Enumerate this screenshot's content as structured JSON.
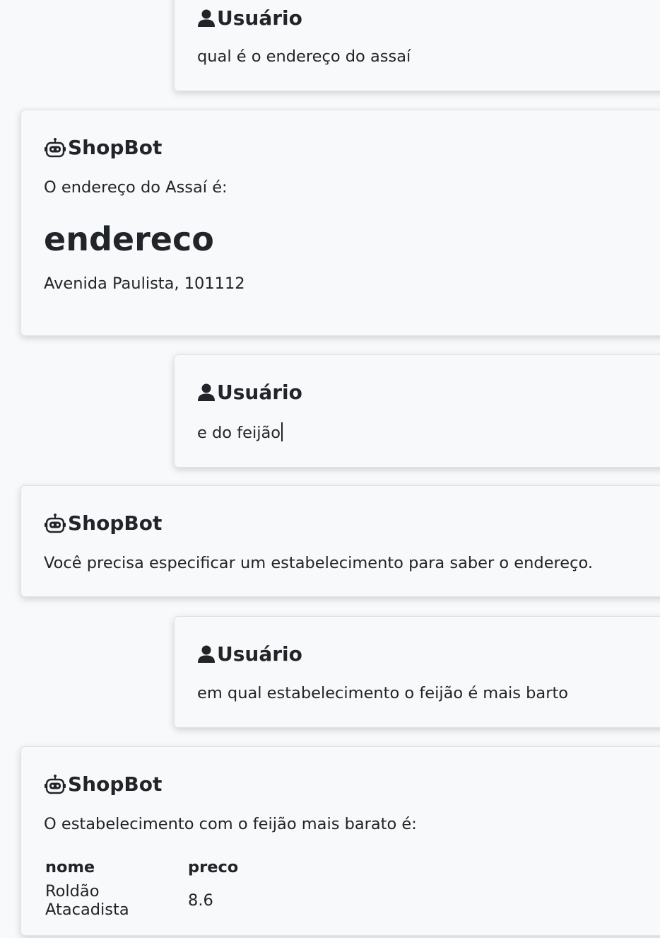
{
  "messages": [
    {
      "sender": "Usuário",
      "text": "qual é o endereço do assaí"
    },
    {
      "sender": "ShopBot",
      "text": "O endereço do Assaí é:",
      "heading": "endereco",
      "detail": "Avenida Paulista, 101112"
    },
    {
      "sender": "Usuário",
      "text": "e do feijão"
    },
    {
      "sender": "ShopBot",
      "text": "Você precisa especificar um estabelecimento para saber o endereço."
    },
    {
      "sender": "Usuário",
      "text": "em qual estabelecimento o feijão é mais barto"
    },
    {
      "sender": "ShopBot",
      "text": "O estabelecimento com o feijão mais barato é:",
      "table": {
        "headers": [
          "nome",
          "preco"
        ],
        "rows": [
          [
            "Roldão Atacadista",
            "8.6"
          ]
        ]
      }
    }
  ],
  "icons": {
    "user": "user-icon",
    "bot": "robot-icon"
  }
}
